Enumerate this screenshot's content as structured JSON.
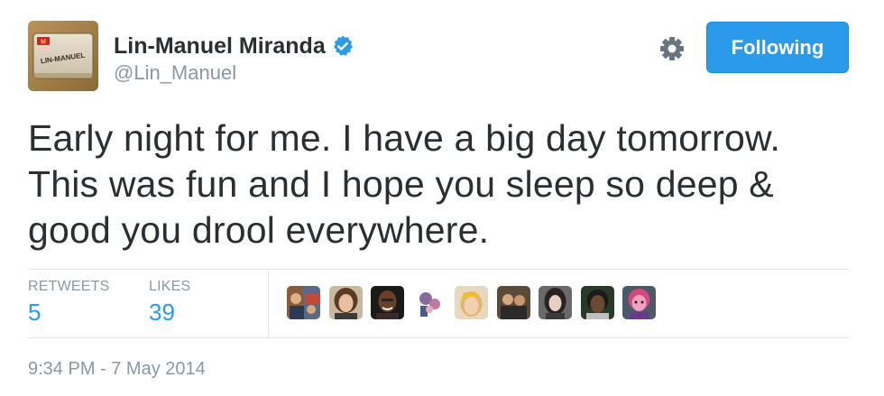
{
  "author": {
    "name": "Lin-Manuel Miranda",
    "handle": "@Lin_Manuel",
    "verified": true,
    "avatar_icon": "name-tag-avatar",
    "avatar_badge_text": "LIN-MANUEL"
  },
  "actions": {
    "settings_icon": "gear-icon",
    "follow_label": "Following"
  },
  "tweet": {
    "line1": "Early night for me. I have a big day tomorrow.",
    "line2": "This was fun and I hope you sleep so deep &",
    "line3": "good you drool everywhere."
  },
  "stats": {
    "retweets_label": "RETWEETS",
    "retweets_count": "5",
    "likes_label": "LIKES",
    "likes_count": "39"
  },
  "likers": [
    {
      "icon": "liker-avatar-1"
    },
    {
      "icon": "liker-avatar-2"
    },
    {
      "icon": "liker-avatar-3"
    },
    {
      "icon": "liker-avatar-4"
    },
    {
      "icon": "liker-avatar-5"
    },
    {
      "icon": "liker-avatar-6"
    },
    {
      "icon": "liker-avatar-7"
    },
    {
      "icon": "liker-avatar-8"
    },
    {
      "icon": "liker-avatar-9"
    }
  ],
  "timestamp": "9:34 PM - 7 May 2014",
  "colors": {
    "accent": "#2b9ae8",
    "text": "#292f33",
    "muted": "#8899a6",
    "divider": "#e1e8ed"
  }
}
